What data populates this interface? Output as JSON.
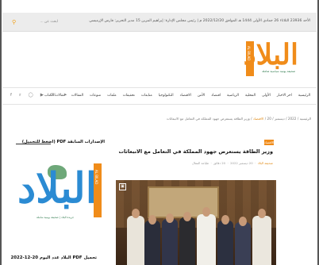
{
  "topbar": {
    "ticker": "الأحد 23936 الثلاثاء 26 جمادى الأولى 1444 هـ الموافق 2022/12/20 م | رئيس مجلس الإدارة: إبراهيم المزين 15 مدير التحرير: فارس الإرميسي",
    "search_placeholder": "ابحث عن ...",
    "search_icon": "search-icon"
  },
  "logo": {
    "text": "البلاد",
    "side_text": "AL BILAD",
    "caption": "صحيفة يومية سياسية شاملة"
  },
  "nav": {
    "items": [
      "الرئيسية",
      "اخر الاخبار",
      "الأولى",
      "المحلية",
      "الرياضية",
      "اقتصاد",
      "الأمن",
      "الاقتصاد",
      "التكنولوجيا",
      "متابعات",
      "تحقيقات",
      "ملفات",
      "منوعات",
      "المقالات",
      "مقالات الكتاب"
    ],
    "social": [
      "facebook-icon",
      "twitter-icon",
      "instagram-icon",
      "youtube-icon",
      "whatsapp-icon",
      "telegram-icon"
    ]
  },
  "breadcrumb": {
    "items": [
      "الرئيسية",
      "2022",
      "ديسمبر",
      "20",
      "الاقتصاد"
    ],
    "current": "وزير الطاقة يستعرض جهود المملكة في التعامل مع الانبعاثات"
  },
  "article": {
    "category": "الاقتصاد",
    "title": "وزير الطاقة يستعرض جهود المملكة في التعامل مع الانبعاثات",
    "meta_author": "صحيفة البلاد",
    "meta_date": "20 ديسمبر 2022",
    "meta_time": "20 دقائق",
    "meta_print": "طباعة المقال"
  },
  "sidebar": {
    "title": "الإصدارات السابقة PDF (اضغط للتحميل)",
    "logo_text": "البلاد",
    "logo_side": "AL BILAD",
    "logo_caption": "جريدة البلاد | صحيفة يومية شاملة",
    "bottom_title": "تحميل PDF البلاد عدد اليوم 20-12-2022"
  },
  "colors": {
    "accent": "#f08c1a",
    "blue": "#2b8bd3",
    "green": "#2f7a4d"
  }
}
